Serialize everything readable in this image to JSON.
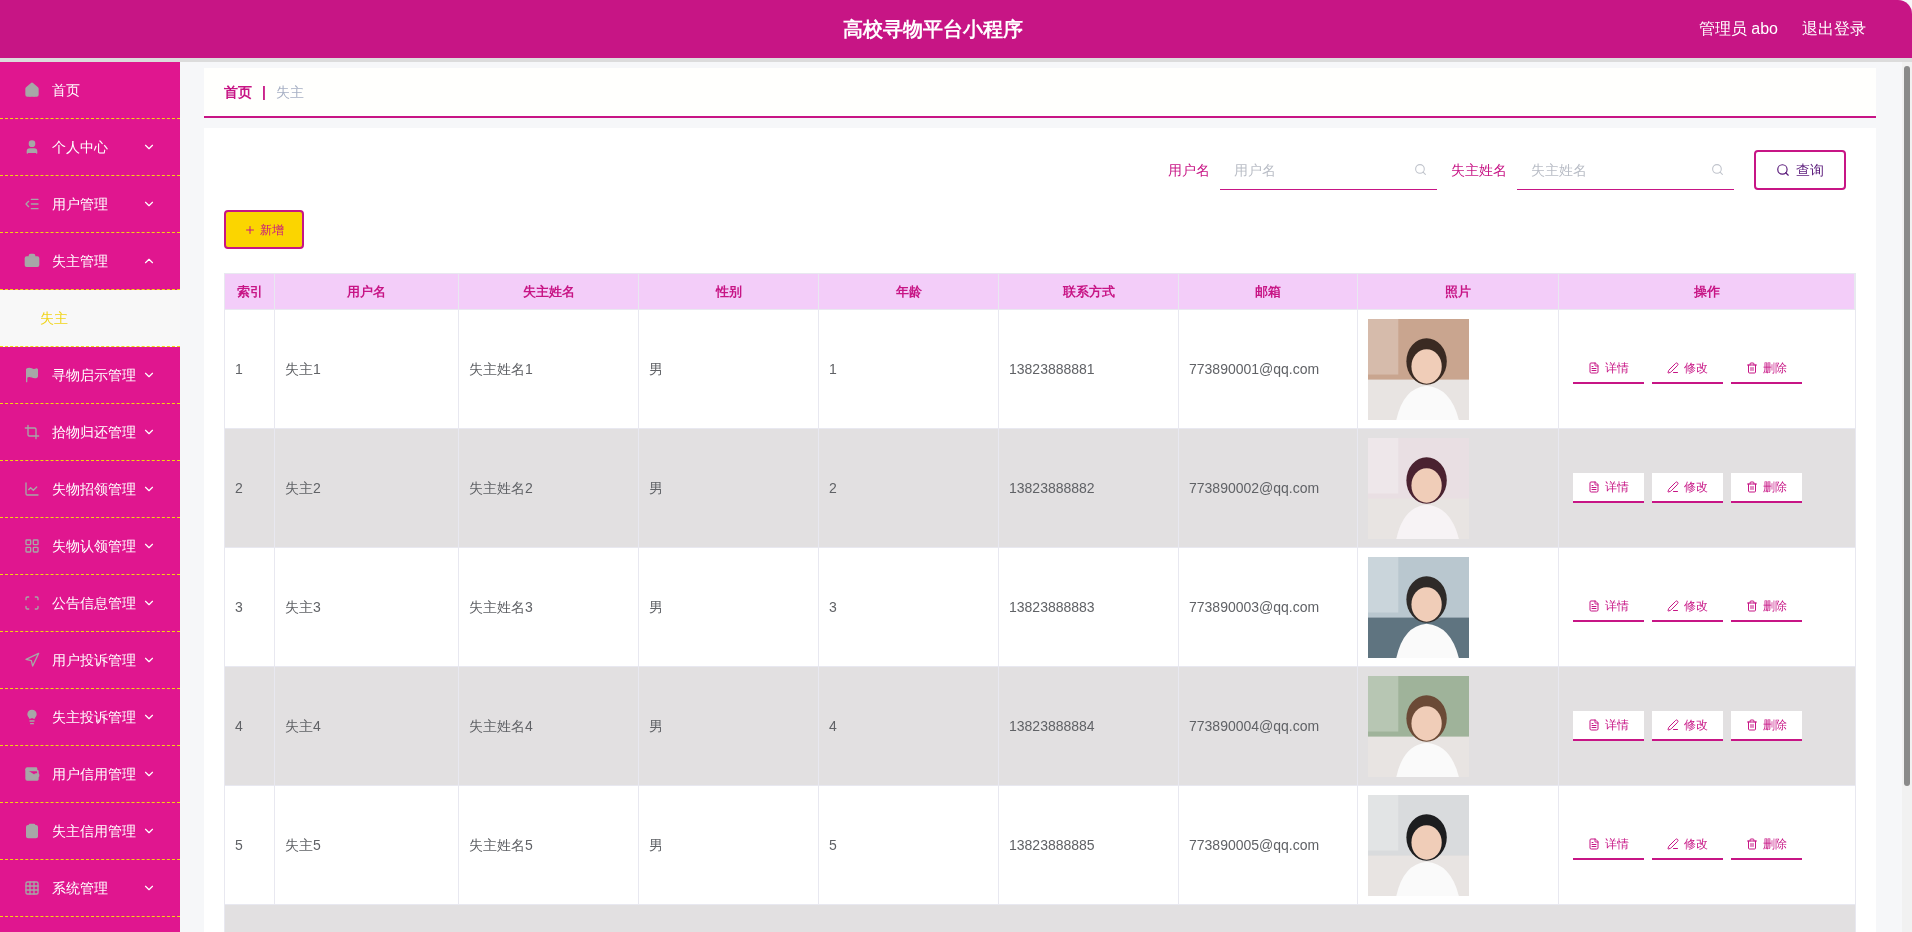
{
  "header": {
    "title": "高校寻物平台小程序",
    "user": "管理员 abo",
    "logout": "退出登录"
  },
  "sidebar": {
    "items": [
      {
        "label": "首页",
        "kind": "link"
      },
      {
        "label": "个人中心",
        "kind": "group",
        "expanded": false
      },
      {
        "label": "用户管理",
        "kind": "group",
        "expanded": false
      },
      {
        "label": "失主管理",
        "kind": "group",
        "expanded": true,
        "children": [
          {
            "label": "失主",
            "selected": true
          }
        ]
      },
      {
        "label": "寻物启示管理",
        "kind": "group",
        "expanded": false
      },
      {
        "label": "拾物归还管理",
        "kind": "group",
        "expanded": false
      },
      {
        "label": "失物招领管理",
        "kind": "group",
        "expanded": false
      },
      {
        "label": "失物认领管理",
        "kind": "group",
        "expanded": false
      },
      {
        "label": "公告信息管理",
        "kind": "group",
        "expanded": false
      },
      {
        "label": "用户投诉管理",
        "kind": "group",
        "expanded": false
      },
      {
        "label": "失主投诉管理",
        "kind": "group",
        "expanded": false
      },
      {
        "label": "用户信用管理",
        "kind": "group",
        "expanded": false
      },
      {
        "label": "失主信用管理",
        "kind": "group",
        "expanded": false
      },
      {
        "label": "系统管理",
        "kind": "group",
        "expanded": false
      }
    ]
  },
  "breadcrumb": {
    "home": "首页",
    "separator": "|",
    "current": "失主"
  },
  "search": {
    "fields": [
      {
        "label": "用户名",
        "placeholder": "用户名"
      },
      {
        "label": "失主姓名",
        "placeholder": "失主姓名"
      }
    ],
    "button": "查询"
  },
  "add_button": "新增",
  "table": {
    "columns": [
      "索引",
      "用户名",
      "失主姓名",
      "性别",
      "年龄",
      "联系方式",
      "邮箱",
      "照片",
      "操作"
    ],
    "rows": [
      {
        "cells": [
          "1",
          "失主1",
          "失主姓名1",
          "男",
          "1",
          "13823888881",
          "773890001@qq.com"
        ],
        "actions": [
          "详情",
          "修改",
          "删除"
        ]
      },
      {
        "cells": [
          "2",
          "失主2",
          "失主姓名2",
          "男",
          "2",
          "13823888882",
          "773890002@qq.com"
        ],
        "actions": [
          "详情",
          "修改",
          "删除"
        ]
      },
      {
        "cells": [
          "3",
          "失主3",
          "失主姓名3",
          "男",
          "3",
          "13823888883",
          "773890003@qq.com"
        ],
        "actions": [
          "详情",
          "修改",
          "删除"
        ]
      },
      {
        "cells": [
          "4",
          "失主4",
          "失主姓名4",
          "男",
          "4",
          "13823888884",
          "773890004@qq.com"
        ],
        "actions": [
          "详情",
          "修改",
          "删除"
        ]
      },
      {
        "cells": [
          "5",
          "失主5",
          "失主姓名5",
          "男",
          "5",
          "13823888885",
          "773890005@qq.com"
        ],
        "actions": [
          "详情",
          "修改",
          "删除"
        ]
      }
    ]
  }
}
